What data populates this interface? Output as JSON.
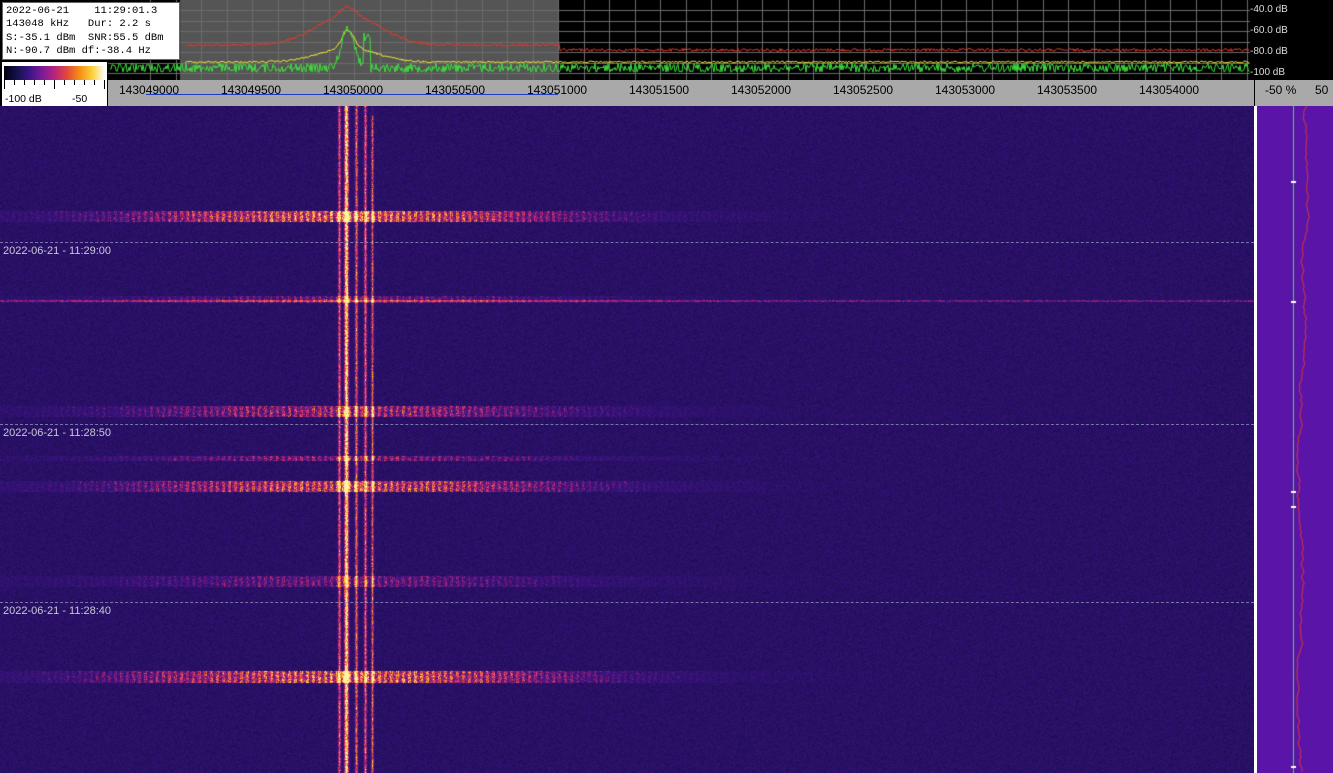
{
  "info": {
    "date": "2022-06-21",
    "time": "11:29:01.3",
    "freq": "143048 kHz",
    "duration": "Dur: 2.2 s",
    "signal": "S:-35.1 dBm",
    "snr": "SNR:55.5 dBm",
    "noise": "N:-90.7 dBm",
    "df": "df:-38.4 Hz"
  },
  "colorbar": {
    "min_label": "-100 dB",
    "max_label": "-50"
  },
  "freq_axis": {
    "labels": [
      "143049000",
      "143049500",
      "143050000",
      "143050500",
      "143051000",
      "143051500",
      "143052000",
      "143052500",
      "143053000",
      "143053500",
      "143054000"
    ]
  },
  "db_axis": {
    "labels": [
      "-40.0 dB",
      "-60.0 dB",
      "-80.0 dB",
      "-100 dB"
    ]
  },
  "right_axis": {
    "left_label": "-50 %",
    "right_label": "50"
  },
  "timestamps": [
    "2022-06-21 - 11:29:00",
    "2022-06-21 - 11:28:50",
    "2022-06-21 - 11:28:40"
  ],
  "colors": {
    "red_trace": "#e23a2e",
    "yellow_trace": "#f0e040",
    "green_trace": "#3ee23e",
    "grid": "#6b6b6b"
  }
}
